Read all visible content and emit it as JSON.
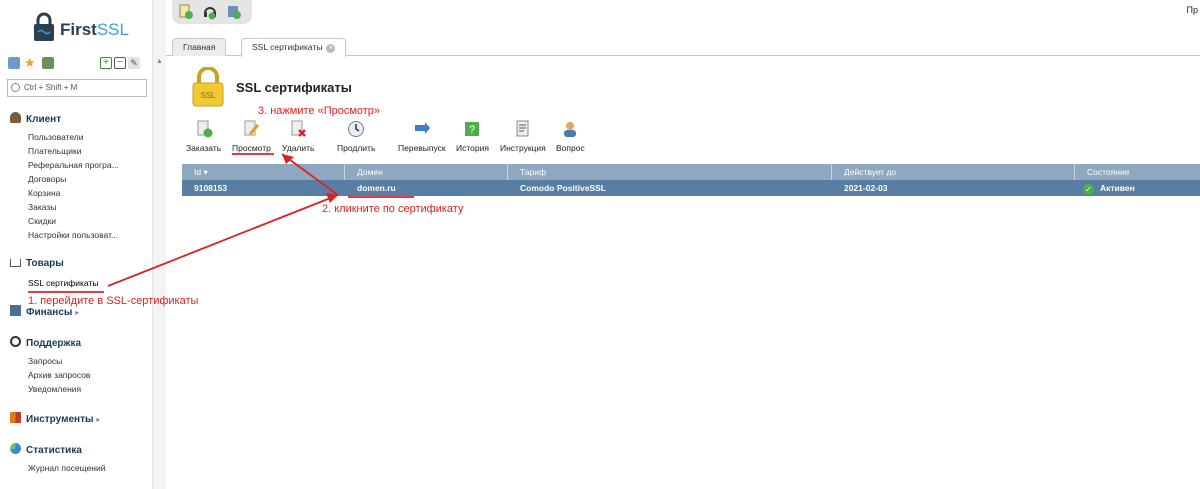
{
  "app": {
    "brand_main": "First",
    "brand_accent": "SSL",
    "user_short": "Пр"
  },
  "sidebar": {
    "search_placeholder": "Ctrl + Shift + M",
    "sections": {
      "client": {
        "title": "Клиент",
        "items": [
          "Пользователи",
          "Плательщики",
          "Реферальная програ...",
          "Договоры",
          "Корзина",
          "Заказы",
          "Скидки",
          "Настройки пользоват..."
        ]
      },
      "goods": {
        "title": "Товары",
        "items": [
          "SSL сертификаты"
        ]
      },
      "finance": {
        "title": "Финансы"
      },
      "support": {
        "title": "Поддержка",
        "items": [
          "Запросы",
          "Архив запросов",
          "Уведомления"
        ]
      },
      "tools": {
        "title": "Инструменты"
      },
      "stats": {
        "title": "Статистика",
        "items": [
          "Журнал посещений"
        ]
      }
    }
  },
  "tabs": [
    {
      "label": "Главная"
    },
    {
      "label": "SSL сертификаты"
    }
  ],
  "page": {
    "title": "SSL сертификаты"
  },
  "toolbar": [
    "Заказать",
    "Просмотр",
    "Удалить",
    "Продлить",
    "Перевыпуск",
    "История",
    "Инструкция",
    "Вопрос"
  ],
  "table": {
    "columns": [
      "Id",
      "Домен",
      "Тариф",
      "Действует до",
      "Состояние"
    ],
    "rows": [
      {
        "id": "9108153",
        "domain": "domen.ru",
        "tariff": "Comodo PositiveSSL",
        "valid_until": "2021-02-03",
        "status": "Активен"
      }
    ]
  },
  "annotations": {
    "step1": "1. перейдите в SSL-сертификаты",
    "step2": "2. кликните по сертификату",
    "step3": "3. нажмите «Просмотр»"
  },
  "colors": {
    "header_row": "#8fa8c0",
    "selected_row": "#587ea3",
    "annotation": "#e02020",
    "status_ok": "#4cae4c"
  }
}
